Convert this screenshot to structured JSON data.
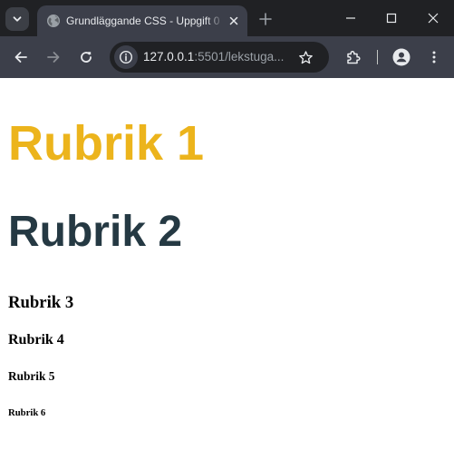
{
  "browser": {
    "tab": {
      "title": "Grundläggande CSS - Uppgift 0",
      "favicon": "globe-icon"
    },
    "address_bar": {
      "host": "127.0.0.1",
      "rest": ":5501/lekstuga...",
      "site_info_icon": "info-icon"
    },
    "colors": {
      "tabstrip_bg": "#202124",
      "toolbar_bg": "#3c3f4a",
      "omnibox_bg": "#202124"
    }
  },
  "page": {
    "headings": {
      "h1": "Rubrik 1",
      "h2": "Rubrik 2",
      "h3": "Rubrik 3",
      "h4": "Rubrik 4",
      "h5": "Rubrik 5",
      "h6": "Rubrik 6"
    },
    "colors": {
      "h1": "#ecb41c",
      "h2": "#253943"
    }
  }
}
